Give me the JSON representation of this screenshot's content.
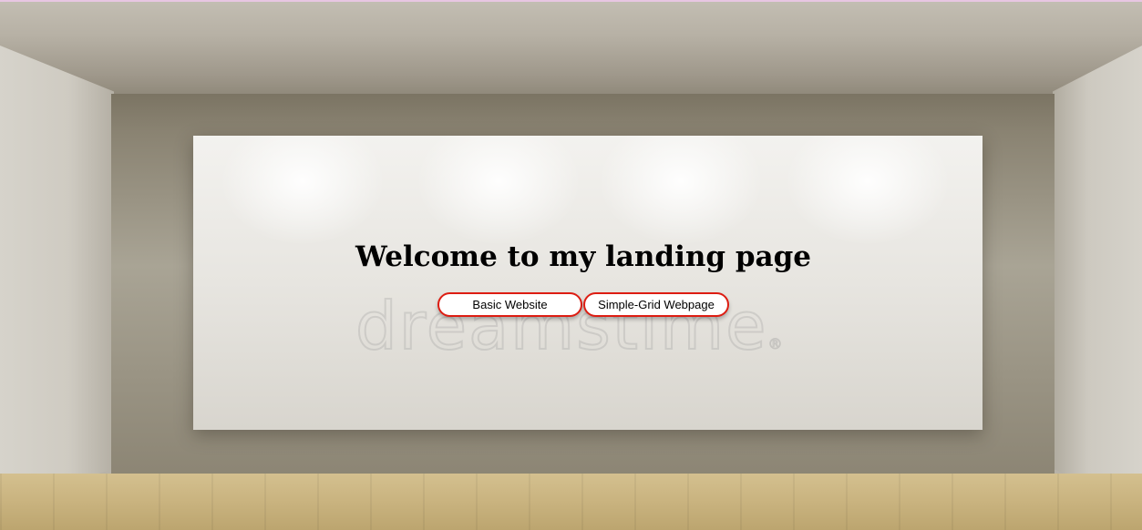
{
  "page": {
    "heading": "Welcome to my landing page"
  },
  "buttons": {
    "basic_label": "Basic Website",
    "grid_label": "Simple-Grid Webpage"
  },
  "background": {
    "watermark_text": "dreamstime",
    "watermark_mark": "®"
  },
  "colors": {
    "button_border": "#dd1d12",
    "top_line": "#e7c6e2"
  }
}
